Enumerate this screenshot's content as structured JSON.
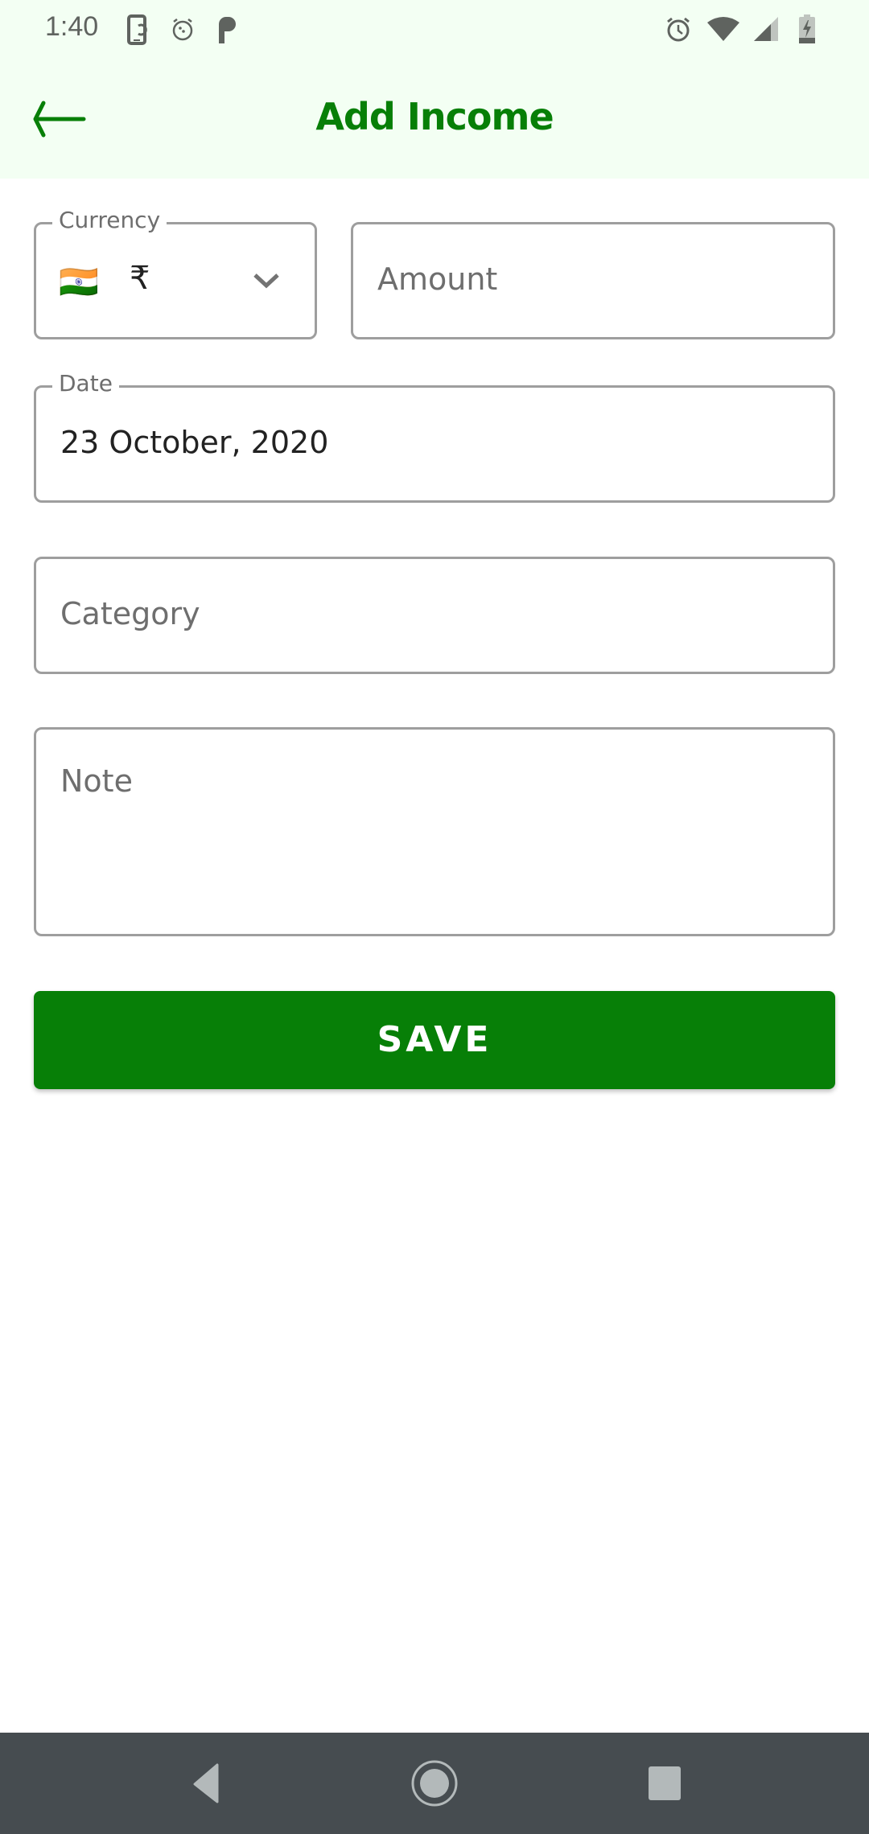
{
  "status_bar": {
    "time": "1:40",
    "left_icons": [
      "screen-rotate-icon",
      "alarm-icon",
      "parking-icon"
    ],
    "right_icons": [
      "alarm-clock-icon",
      "wifi-icon",
      "signal-icon",
      "battery-charging-icon"
    ]
  },
  "app_bar": {
    "title": "Add Income",
    "back_icon": "arrow-left-icon"
  },
  "form": {
    "currency": {
      "label": "Currency",
      "flag": "🇮🇳",
      "symbol": "₹",
      "dropdown_icon": "chevron-down-icon"
    },
    "amount": {
      "placeholder": "Amount",
      "value": ""
    },
    "date": {
      "label": "Date",
      "value": "23 October, 2020"
    },
    "category": {
      "placeholder": "Category",
      "value": ""
    },
    "note": {
      "placeholder": "Note",
      "value": ""
    },
    "save_label": "SAVE"
  },
  "colors": {
    "accent": "#077f07",
    "header_bg": "#f3fff3",
    "nav_bg": "#464c50"
  },
  "nav_bar": {
    "buttons": [
      "back-icon",
      "home-icon",
      "recents-icon"
    ]
  }
}
